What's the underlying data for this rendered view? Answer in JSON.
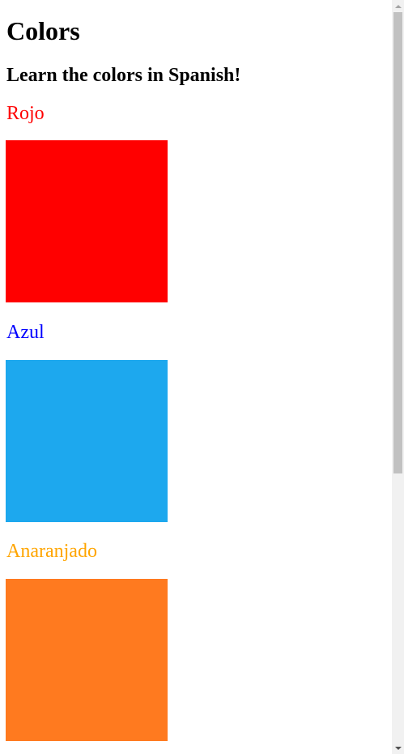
{
  "page": {
    "title": "Colors",
    "subtitle": "Learn the colors in Spanish!"
  },
  "colors": [
    {
      "name": "Rojo",
      "label_color": "#ff0000",
      "swatch_color": "#ff0000"
    },
    {
      "name": "Azul",
      "label_color": "#0000ff",
      "swatch_color": "#1da8ee"
    },
    {
      "name": "Anaranjado",
      "label_color": "#ffa500",
      "swatch_color": "#ff7a1f"
    }
  ],
  "scrollbar": {
    "up_icon": "arrow-up-icon",
    "down_icon": "arrow-down-icon"
  }
}
